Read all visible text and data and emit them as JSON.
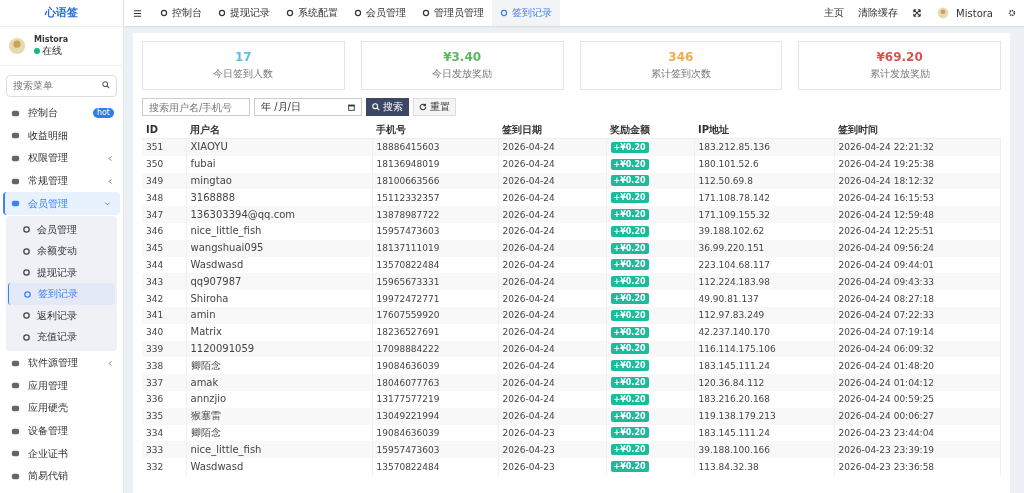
{
  "brand": "心语签",
  "user": {
    "name": "Mistora",
    "status": "在线"
  },
  "sidebar": {
    "search_placeholder": "搜索菜单",
    "items": [
      {
        "label": "控制台",
        "badge": "hot",
        "selected": false,
        "has_children": false
      },
      {
        "label": "收益明细",
        "selected": false,
        "has_children": false
      },
      {
        "label": "权限管理",
        "expanded": false,
        "selected": false,
        "has_children": true
      },
      {
        "label": "常规管理",
        "expanded": false,
        "selected": false,
        "has_children": true
      },
      {
        "label": "会员管理",
        "expanded": true,
        "selected": true,
        "has_children": true,
        "children": [
          {
            "label": "会员管理",
            "selected": false
          },
          {
            "label": "余额变动",
            "selected": false
          },
          {
            "label": "提现记录",
            "selected": false
          },
          {
            "label": "签到记录",
            "selected": true
          },
          {
            "label": "返利记录",
            "selected": false
          },
          {
            "label": "充值记录",
            "selected": false
          }
        ]
      },
      {
        "label": "软件源管理",
        "expanded": false,
        "selected": false,
        "has_children": true
      },
      {
        "label": "应用管理",
        "selected": false,
        "has_children": false
      },
      {
        "label": "应用硬壳",
        "selected": false,
        "has_children": false
      },
      {
        "label": "设备管理",
        "selected": false,
        "has_children": false
      },
      {
        "label": "企业证书",
        "selected": false,
        "has_children": false
      },
      {
        "label": "简易代销",
        "selected": false,
        "has_children": false
      }
    ]
  },
  "tabs": [
    {
      "label": "控制台",
      "selected": false
    },
    {
      "label": "提现记录",
      "selected": false
    },
    {
      "label": "系统配置",
      "selected": false
    },
    {
      "label": "会员管理",
      "selected": false
    },
    {
      "label": "管理员管理",
      "selected": false
    },
    {
      "label": "签到记录",
      "selected": true
    }
  ],
  "header_right": {
    "home": "主页",
    "clear_cache": "清除缓存",
    "user": "Mistora"
  },
  "stats": [
    {
      "value": "17",
      "label": "今日签到人数",
      "color": "#5bc0de"
    },
    {
      "value": "¥3.40",
      "label": "今日发放奖励",
      "color": "#5cb85c"
    },
    {
      "value": "346",
      "label": "累计签到次数",
      "color": "#f0ad4e"
    },
    {
      "value": "¥69.20",
      "label": "累计发放奖励",
      "color": "#d9534f"
    }
  ],
  "filters": {
    "search_placeholder": "搜索用户名/手机号",
    "date_placeholder": "年 /月/日",
    "search_button": "搜索",
    "reset_button": "重置"
  },
  "table": {
    "columns": [
      "ID",
      "用户名",
      "手机号",
      "签到日期",
      "奖励金额",
      "IP地址",
      "签到时间"
    ],
    "rows": [
      [
        "351",
        "XIAOYU",
        "18886415603",
        "2026-04-24",
        "+¥0.20",
        "183.212.85.136",
        "2026-04-24 22:21:32"
      ],
      [
        "350",
        "fubai",
        "18136948019",
        "2026-04-24",
        "+¥0.20",
        "180.101.52.6",
        "2026-04-24 19:25:38"
      ],
      [
        "349",
        "mingtao",
        "18100663566",
        "2026-04-24",
        "+¥0.20",
        "112.50.69.8",
        "2026-04-24 18:12:32"
      ],
      [
        "348",
        "3168888",
        "15112332357",
        "2026-04-24",
        "+¥0.20",
        "171.108.78.142",
        "2026-04-24 16:15:53"
      ],
      [
        "347",
        "136303394@qq.com",
        "13878987722",
        "2026-04-24",
        "+¥0.20",
        "171.109.155.32",
        "2026-04-24 12:59:48"
      ],
      [
        "346",
        "nice_little_fish",
        "15957473603",
        "2026-04-24",
        "+¥0.20",
        "39.188.102.62",
        "2026-04-24 12:25:51"
      ],
      [
        "345",
        "wangshuai095",
        "18137111019",
        "2026-04-24",
        "+¥0.20",
        "36.99.220.151",
        "2026-04-24 09:56:24"
      ],
      [
        "344",
        "Wasdwasd",
        "13570822484",
        "2026-04-24",
        "+¥0.20",
        "223.104.68.117",
        "2026-04-24 09:44:01"
      ],
      [
        "343",
        "qq907987",
        "15965673331",
        "2026-04-24",
        "+¥0.20",
        "112.224.183.98",
        "2026-04-24 09:43:33"
      ],
      [
        "342",
        "Shiroha",
        "19972472771",
        "2026-04-24",
        "+¥0.20",
        "49.90.81.137",
        "2026-04-24 08:27:18"
      ],
      [
        "341",
        "amin",
        "17607559920",
        "2026-04-24",
        "+¥0.20",
        "112.97.83.249",
        "2026-04-24 07:22:33"
      ],
      [
        "340",
        "Matrix",
        "18236527691",
        "2026-04-24",
        "+¥0.20",
        "42.237.140.170",
        "2026-04-24 07:19:14"
      ],
      [
        "339",
        "1120091059",
        "17098884222",
        "2026-04-24",
        "+¥0.20",
        "116.114.175.106",
        "2026-04-24 06:09:32"
      ],
      [
        "338",
        "卿陌念",
        "19084636039",
        "2026-04-24",
        "+¥0.20",
        "183.145.111.24",
        "2026-04-24 01:48:20"
      ],
      [
        "337",
        "amak",
        "18046077763",
        "2026-04-24",
        "+¥0.20",
        "120.36.84.112",
        "2026-04-24 01:04:12"
      ],
      [
        "336",
        "annzjio",
        "13177577219",
        "2026-04-24",
        "+¥0.20",
        "183.216.20.168",
        "2026-04-24 00:59:25"
      ],
      [
        "335",
        "猴塞雷",
        "13049221994",
        "2026-04-24",
        "+¥0.20",
        "119.138.179.213",
        "2026-04-24 00:06:27"
      ],
      [
        "334",
        "卿陌念",
        "19084636039",
        "2026-04-23",
        "+¥0.20",
        "183.145.111.24",
        "2026-04-23 23:44:04"
      ],
      [
        "333",
        "nice_little_fish",
        "15957473603",
        "2026-04-23",
        "+¥0.20",
        "39.188.100.166",
        "2026-04-23 23:39:19"
      ],
      [
        "332",
        "Wasdwasd",
        "13570822484",
        "2026-04-23",
        "+¥0.20",
        "113.84.32.38",
        "2026-04-23 23:36:58"
      ]
    ]
  }
}
